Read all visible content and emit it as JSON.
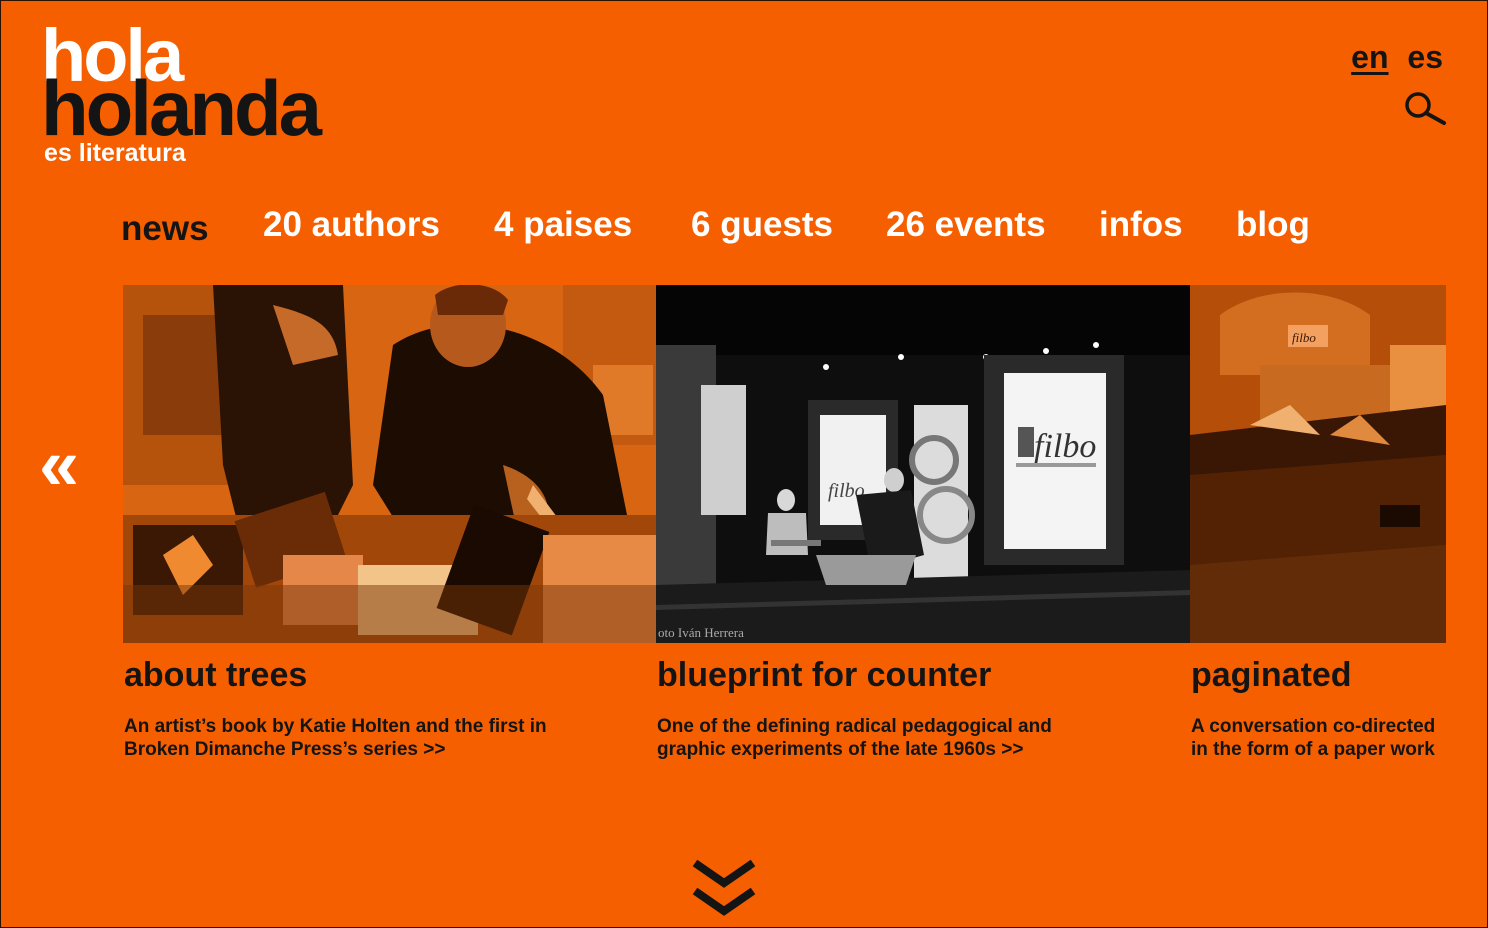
{
  "logo": {
    "line1": "hola",
    "line2": "holanda",
    "tagline": "es literatura"
  },
  "languages": {
    "active": "en",
    "other": "es"
  },
  "icons": {
    "search": "search-icon",
    "previous": "chevron-left-double-icon",
    "scroll_down": "chevron-down-double-icon"
  },
  "nav": {
    "items": [
      {
        "label": "news"
      },
      {
        "label": "20 authors"
      },
      {
        "label": "4 paises"
      },
      {
        "label": "6 guests"
      },
      {
        "label": "26 events"
      },
      {
        "label": "infos"
      },
      {
        "label": "blog"
      }
    ]
  },
  "carousel": {
    "prev_label": "«",
    "cards": [
      {
        "title": "about trees",
        "desc_line1": "An artist’s book by Katie Holten and the first in",
        "desc_line2": "Broken Dimanche Press’s series >>"
      },
      {
        "title": "blueprint for counter",
        "desc_line1": "One of the defining radical pedagogical and",
        "desc_line2": "graphic experiments of the late 1960s >>",
        "image_text": {
          "banner": "filbo",
          "banner_small": "filbo",
          "credit": "oto Iván Herrera"
        }
      },
      {
        "title": "paginated",
        "desc_line1": "A conversation co-directed",
        "desc_line2": "in the form of a paper work",
        "image_text": {
          "sign": "filbo"
        }
      }
    ]
  },
  "colors": {
    "background": "#f55f00",
    "text_dark": "#141414",
    "text_light": "#ffffff"
  }
}
